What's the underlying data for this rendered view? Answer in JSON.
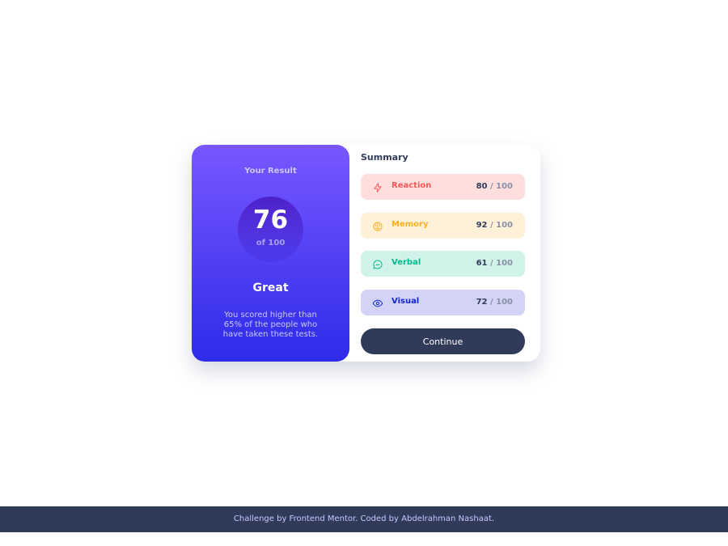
{
  "result": {
    "heading": "Your Result",
    "score": "76",
    "score_of": "of 100",
    "rating": "Great",
    "description": "You scored higher than 65% of the people who have taken these tests."
  },
  "summary": {
    "title": "Summary",
    "items": [
      {
        "label": "Reaction",
        "score": "80",
        "max": " / 100",
        "icon": "lightning-icon",
        "color": "#ff5757",
        "bg": "#ffdede"
      },
      {
        "label": "Memory",
        "score": "92",
        "max": " / 100",
        "icon": "brain-icon",
        "color": "#ffb01f",
        "bg": "#fff1d8"
      },
      {
        "label": "Verbal",
        "score": "61",
        "max": " / 100",
        "icon": "chat-icon",
        "color": "#00bb8f",
        "bg": "#d0f2e9"
      },
      {
        "label": "Visual",
        "score": "72",
        "max": " / 100",
        "icon": "eye-icon",
        "color": "#1125d4",
        "bg": "#d3d3f7"
      }
    ],
    "continue_label": "Continue"
  },
  "footer": {
    "text": "Challenge by Frontend Mentor. Coded by Abdelrahman Nashaat."
  },
  "colors": {
    "gradient_top": "#7857ff",
    "gradient_bottom": "#2e2be9",
    "dark_navy": "#303b5a"
  }
}
